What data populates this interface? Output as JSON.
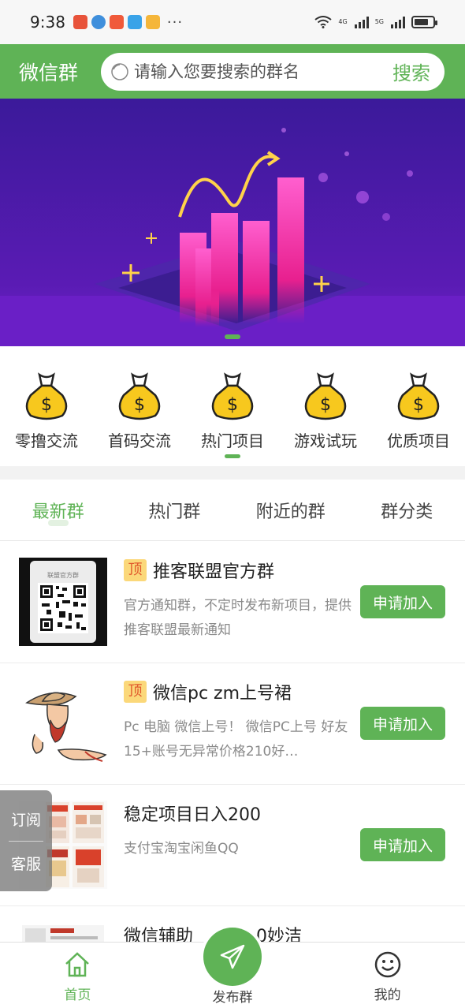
{
  "status_bar": {
    "time": "9:38",
    "dots": "···",
    "net1": "4G",
    "net2": "5G",
    "battery_level": 0.75
  },
  "header": {
    "title": "微信群",
    "search_placeholder": "请输入您要搜索的群名",
    "search_button": "搜索"
  },
  "categories": [
    {
      "label": "零撸交流"
    },
    {
      "label": "首码交流"
    },
    {
      "label": "热门项目"
    },
    {
      "label": "游戏试玩"
    },
    {
      "label": "优质项目"
    }
  ],
  "tabs": [
    {
      "label": "最新群",
      "active": true
    },
    {
      "label": "热门群"
    },
    {
      "label": "附近的群"
    },
    {
      "label": "群分类"
    }
  ],
  "groups": [
    {
      "badge": "顶",
      "title": "推客联盟官方群",
      "desc": "官方通知群，不定时发布新项目，提供推客联盟最新通知",
      "button": "申请加入",
      "qr_caption": "联盟官方群"
    },
    {
      "badge": "顶",
      "title": "微信pc zm上号裙",
      "desc": "Pc 电脑 微信上号！ 微信PC上号 好友15+账号无异常价格210好…",
      "button": "申请加入"
    },
    {
      "badge": "",
      "title": "稳定项目日入200",
      "desc": "支付宝淘宝闲鱼QQ",
      "button": "申请加入"
    },
    {
      "badge": "",
      "title": "微信辅助",
      "title_tail": "0妙洁",
      "desc": "",
      "button": ""
    }
  ],
  "float": {
    "subscribe": "订阅",
    "service": "客服"
  },
  "bottom_nav": {
    "home": "首页",
    "publish": "发布群",
    "mine": "我的"
  },
  "colors": {
    "accent": "#5fb356",
    "badge_bg": "#fbd87a",
    "badge_text": "#e0582b"
  }
}
